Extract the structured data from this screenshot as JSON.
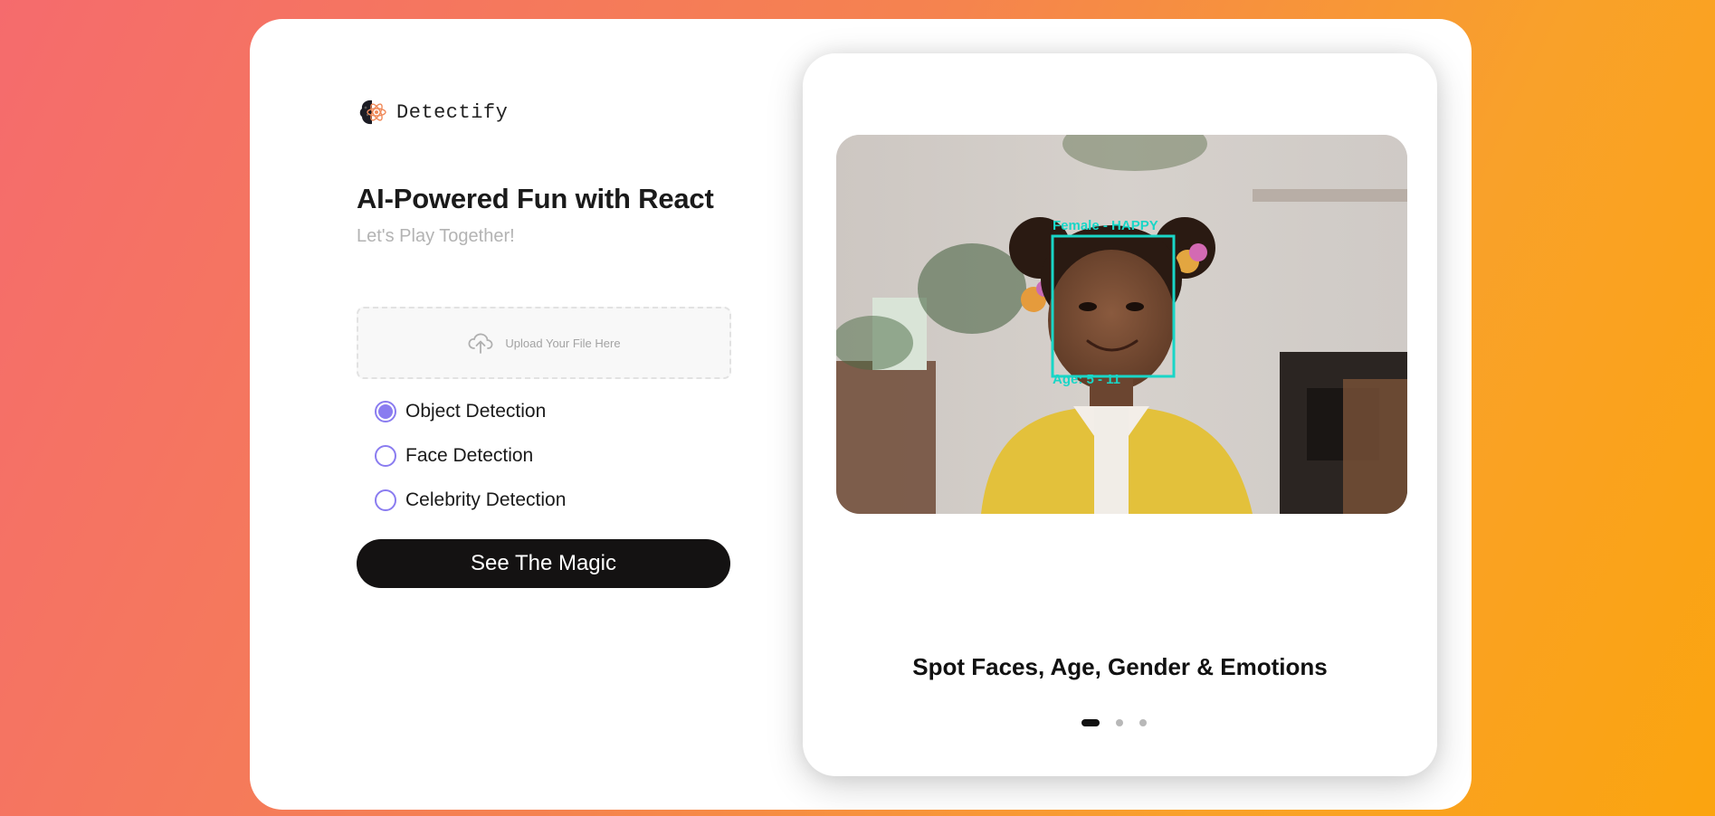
{
  "brand": {
    "name": "Detectify",
    "logo_icon": "brain-atom-icon"
  },
  "hero": {
    "title": "AI-Powered Fun with React",
    "subtitle": "Let's Play Together!"
  },
  "upload": {
    "label": "Upload Your File Here",
    "icon": "cloud-upload-icon"
  },
  "options": [
    {
      "label": "Object Detection",
      "checked": true
    },
    {
      "label": "Face Detection",
      "checked": false
    },
    {
      "label": "Celebrity Detection",
      "checked": false
    }
  ],
  "action": {
    "label": "See The Magic"
  },
  "showcase": {
    "face_top_label": "Female - HAPPY",
    "face_bottom_label": "Age: 5 - 11",
    "caption": "Spot Faces, Age, Gender & Emotions",
    "slides_count": 3,
    "active_slide": 0
  },
  "colors": {
    "accent": "#8a7cf0",
    "detection_box": "#19d6c7",
    "button_bg": "#141212"
  }
}
